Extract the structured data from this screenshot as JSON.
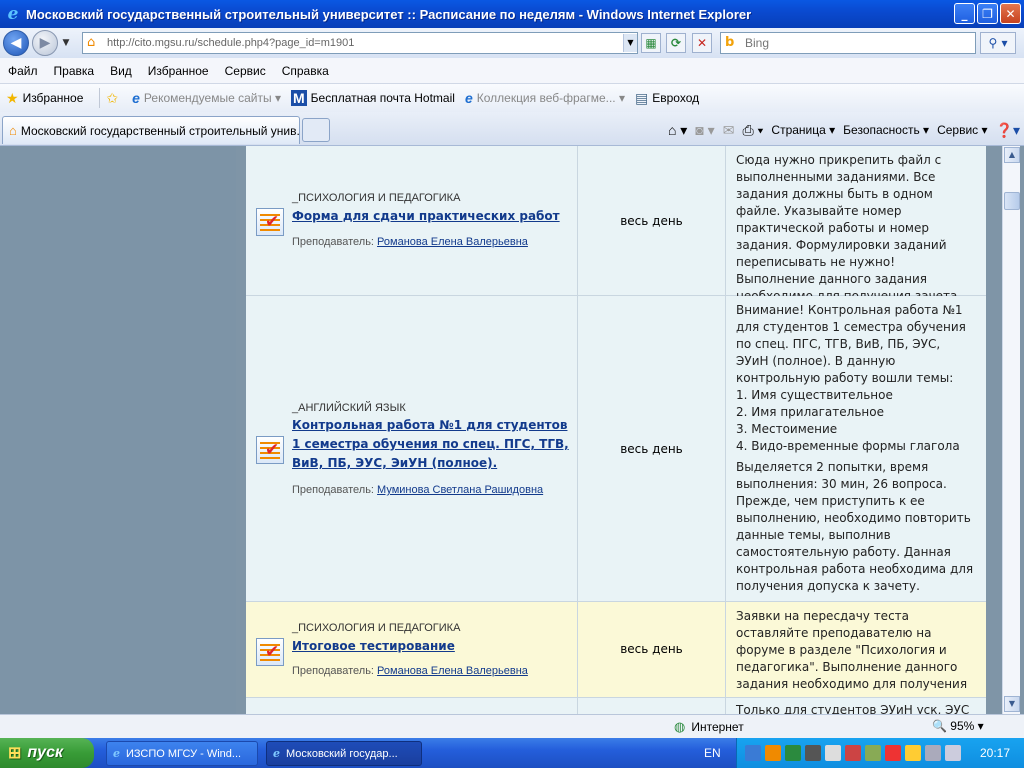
{
  "window": {
    "title": "Московский государственный строительный университет :: Расписание по неделям - Windows Internet Explorer"
  },
  "address": {
    "url": "http://cito.mgsu.ru/schedule.php4?page_id=m1901",
    "search_placeholder": "Bing"
  },
  "menu": [
    "Файл",
    "Правка",
    "Вид",
    "Избранное",
    "Сервис",
    "Справка"
  ],
  "favorites": {
    "favorites_label": "Избранное",
    "items": [
      {
        "label": "Рекомендуемые сайты ▾"
      },
      {
        "label": "Бесплатная почта Hotmail"
      },
      {
        "label": "Коллекция веб-фрагме... ▾"
      },
      {
        "label": "Евроход"
      }
    ]
  },
  "tab": {
    "label": "Московский государственный строительный унив..."
  },
  "commandbar": {
    "page": "Страница ▾",
    "safety": "Безопасность ▾",
    "service": "Сервис ▾"
  },
  "schedule": {
    "rows": [
      {
        "course": "_ПСИХОЛОГИЯ И ПЕДАГОГИКА",
        "activity": "Форма для сдачи практических работ",
        "teacher_prefix": "Преподаватель: ",
        "teacher": "Романова Елена Валерьевна",
        "time": "весь день",
        "note": "Сюда нужно прикрепить файл с выполненными заданиями. Все задания должны быть в одном файле. Указывайте номер практической работы и номер задания. Формулировки заданий переписывать не нужно! Выполнение данного задания необходимо для получения зачета."
      },
      {
        "course": "_АНГЛИЙСКИЙ ЯЗЫК",
        "activity": "Контрольная работа №1 для студентов 1 семестра обучения по спец. ПГС, ТГВ, ВиВ, ПБ, ЭУС, ЭиУН (полное).",
        "teacher_prefix": "Преподаватель: ",
        "teacher": "Муминова Светлана Рашидовна",
        "time": "весь день",
        "note_intro": "Внимание! Контрольная работа №1 для студентов 1 семестра обучения по спец. ПГС, ТГВ, ВиВ, ПБ, ЭУС, ЭУиН (полное). В данную контрольную работу вошли темы:",
        "note_topics": [
          "1. Имя существительное",
          "2. Имя прилагательное",
          "3. Местоимение",
          "4. Видо-временные формы глагола"
        ],
        "note_outro": "Выделяется 2 попытки, время выполнения: 30 мин, 26 вопроса. Прежде, чем приступить к ее выполнению, необходимо повторить данные темы, выполнив самостоятельную работу. Данная контрольная работа необходима для получения допуска к зачету."
      },
      {
        "course": "_ПСИХОЛОГИЯ И ПЕДАГОГИКА",
        "activity": "Итоговое тестирование",
        "teacher_prefix": "Преподаватель: ",
        "teacher": "Романова Елена Валерьевна",
        "time": "весь день",
        "note": "Заявки на пересдачу теста оставляйте преподавателю на форуме в разделе \"Психология и педагогика\". Выполнение данного задания необходимо для получения зачета."
      }
    ],
    "partial_row_note": "Только для студентов ЭУиН уск, ЭУС"
  },
  "status": {
    "zone": "Интернет",
    "zoom": "🔍 95% ▾"
  },
  "taskbar": {
    "start": "пуск",
    "items": [
      "ИЗСПО МГСУ - Wind...",
      "Московский государ..."
    ],
    "lang": "EN",
    "clock": "20:17"
  }
}
